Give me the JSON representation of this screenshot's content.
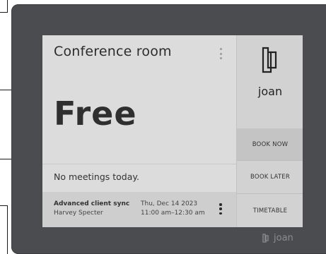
{
  "room": {
    "title": "Conference room",
    "status": "Free",
    "no_meetings_text": "No meetings today."
  },
  "meeting": {
    "name": "Advanced client sync",
    "host": "Harvey Specter",
    "date": "Thu, Dec 14 2023",
    "time": "11:00 am–12:30 am"
  },
  "brand": {
    "name": "joan",
    "logo_icon": "joan-logo-icon"
  },
  "actions": {
    "book_now": "BOOK NOW",
    "book_later": "BOOK LATER",
    "timetable": "TIMETABLE"
  },
  "colors": {
    "bezel": "#4a4c4f",
    "screen": "#dcdcdc",
    "accent_button": "#c4c4c4"
  }
}
